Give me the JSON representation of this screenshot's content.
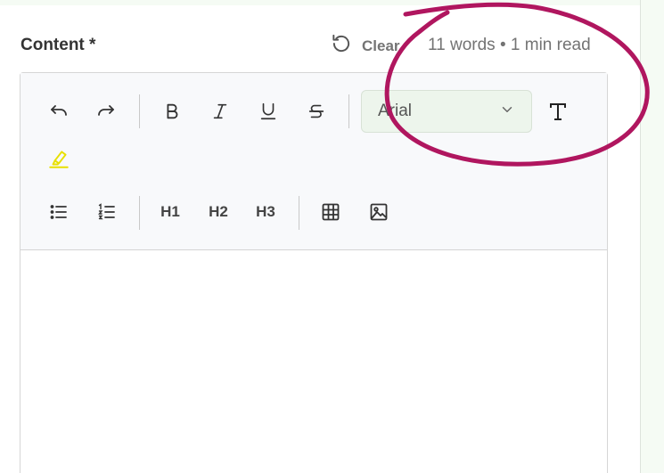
{
  "field": {
    "label": "Content *",
    "clear_label": "Clear",
    "stats": "11 words • 1 min read"
  },
  "toolbar": {
    "row1": [
      "undo-icon",
      "redo-icon",
      "bold-icon",
      "italic-icon",
      "underline-icon",
      "strikethrough-icon"
    ],
    "font_family": "Arial",
    "text_color_icon": "text-color-icon",
    "highlight_icon": "highlight-icon",
    "headings": [
      "H1",
      "H2",
      "H3"
    ],
    "row2": [
      "bullet-list-icon",
      "numbered-list-icon",
      "table-icon",
      "image-icon"
    ]
  },
  "colors": {
    "annotation": "#b0165f",
    "highlight": "#e8e000",
    "page_bg": "#f5fbf4",
    "select_bg": "#edf5ec"
  }
}
